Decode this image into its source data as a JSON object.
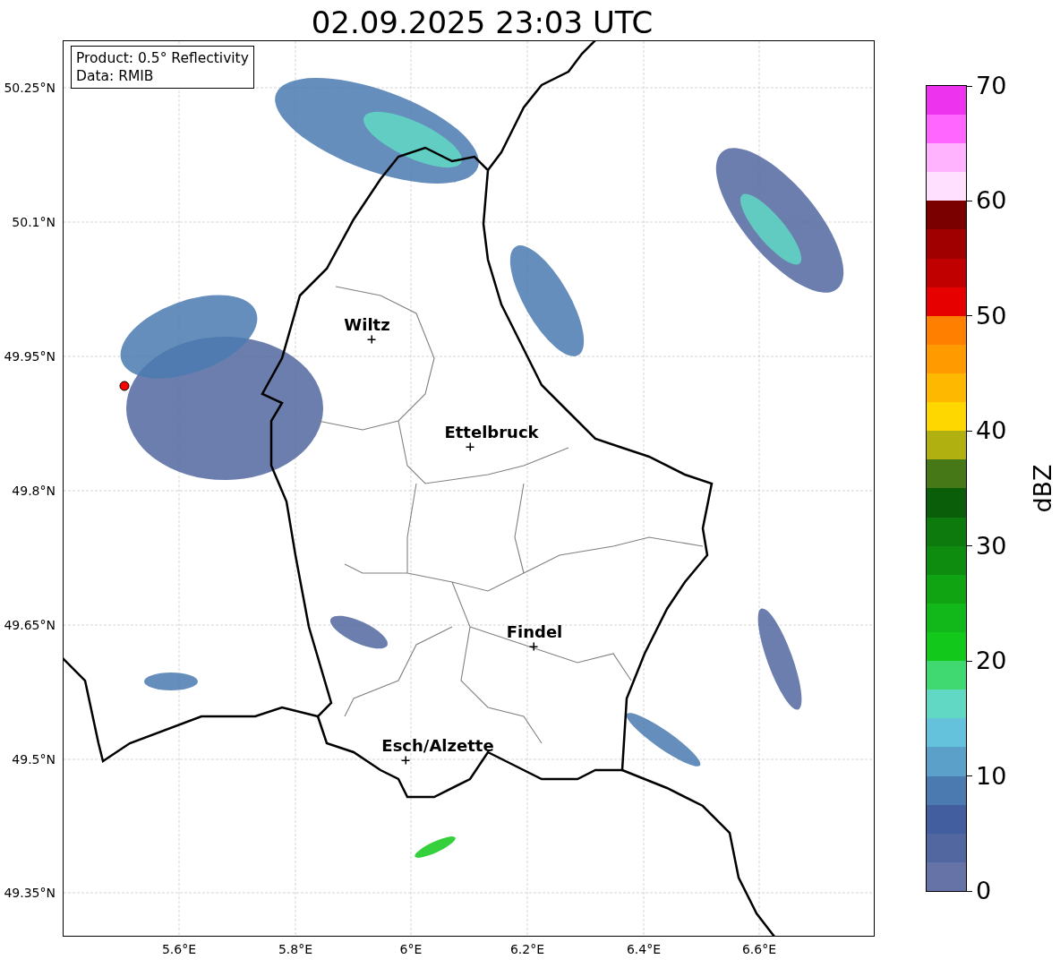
{
  "title": "02.09.2025 23:03 UTC",
  "info_box": {
    "lines": [
      "Product: 0.5° Reflectivity",
      "Data: RMIB"
    ]
  },
  "map": {
    "latitude_ticks": [
      "50.25°N",
      "50.1°N",
      "49.95°N",
      "49.8°N",
      "49.65°N",
      "49.5°N",
      "49.35°N"
    ],
    "longitude_ticks": [
      "5.6°E",
      "5.8°E",
      "6°E",
      "6.2°E",
      "6.4°E",
      "6.6°E"
    ],
    "cities": [
      {
        "name": "Wiltz"
      },
      {
        "name": "Ettelbruck"
      },
      {
        "name": "Findel"
      },
      {
        "name": "Esch/Alzette"
      }
    ]
  },
  "colorbar": {
    "label": "dBZ",
    "ticks": [
      "70",
      "60",
      "50",
      "40",
      "30",
      "20",
      "10",
      "0"
    ],
    "segments": [
      {
        "color": "#6673a6"
      },
      {
        "color": "#52679f"
      },
      {
        "color": "#435e9f"
      },
      {
        "color": "#4a7ab0"
      },
      {
        "color": "#5aa0c8"
      },
      {
        "color": "#64c2dc"
      },
      {
        "color": "#60d8c4"
      },
      {
        "color": "#40d870"
      },
      {
        "color": "#12c81a"
      },
      {
        "color": "#12b81a"
      },
      {
        "color": "#10a412"
      },
      {
        "color": "#0e8c10"
      },
      {
        "color": "#0c7a0c"
      },
      {
        "color": "#0a5e0a"
      },
      {
        "color": "#467818"
      },
      {
        "color": "#b0b010"
      },
      {
        "color": "#ffd700"
      },
      {
        "color": "#ffb800"
      },
      {
        "color": "#ff9a00"
      },
      {
        "color": "#ff7f00"
      },
      {
        "color": "#e60000"
      },
      {
        "color": "#c00000"
      },
      {
        "color": "#a00000"
      },
      {
        "color": "#7a0000"
      },
      {
        "color": "#ffe0ff"
      },
      {
        "color": "#ffb3ff"
      },
      {
        "color": "#ff66ff"
      },
      {
        "color": "#ee33ee"
      }
    ]
  }
}
